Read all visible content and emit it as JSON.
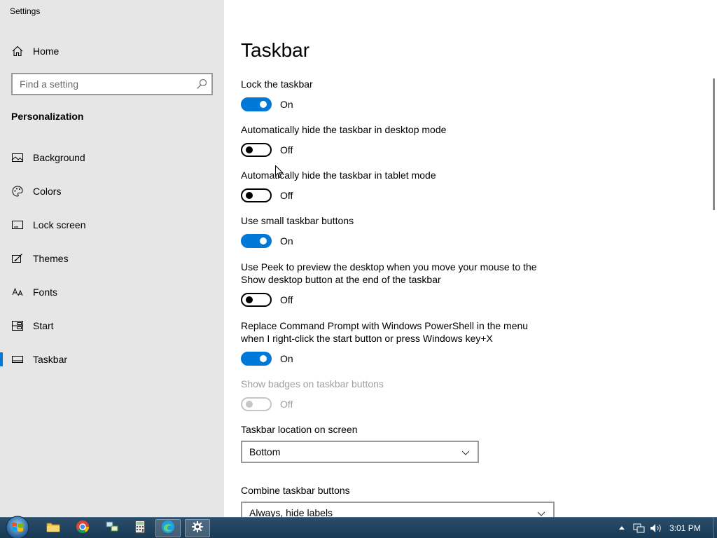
{
  "window": {
    "app_title": "Settings",
    "caption_buttons": [
      "minimize",
      "maximize",
      "close"
    ]
  },
  "nav": {
    "home_label": "Home",
    "search_placeholder": "Find a setting",
    "section_title": "Personalization",
    "items": [
      {
        "label": "Background",
        "icon": "picture-icon",
        "selected": false
      },
      {
        "label": "Colors",
        "icon": "palette-icon",
        "selected": false
      },
      {
        "label": "Lock screen",
        "icon": "lock-screen-icon",
        "selected": false
      },
      {
        "label": "Themes",
        "icon": "brush-icon",
        "selected": false
      },
      {
        "label": "Fonts",
        "icon": "font-icon",
        "selected": false
      },
      {
        "label": "Start",
        "icon": "start-tiles-icon",
        "selected": false
      },
      {
        "label": "Taskbar",
        "icon": "taskbar-icon",
        "selected": true
      }
    ],
    "accent_color": "#0078d7"
  },
  "main": {
    "page_title": "Taskbar",
    "settings": [
      {
        "label": "Lock the taskbar",
        "state": "On",
        "enabled": true
      },
      {
        "label": "Automatically hide the taskbar in desktop mode",
        "state": "Off",
        "enabled": true
      },
      {
        "label": "Automatically hide the taskbar in tablet mode",
        "state": "Off",
        "enabled": true
      },
      {
        "label": "Use small taskbar buttons",
        "state": "On",
        "enabled": true
      },
      {
        "label": "Use Peek to preview the desktop when you move your mouse to the Show desktop button at the end of the taskbar",
        "state": "Off",
        "enabled": true
      },
      {
        "label": "Replace Command Prompt with Windows PowerShell in the menu when I right-click the start button or press Windows key+X",
        "state": "On",
        "enabled": true
      },
      {
        "label": "Show badges on taskbar buttons",
        "state": "Off",
        "enabled": false
      }
    ],
    "location": {
      "label": "Taskbar location on screen",
      "value": "Bottom"
    },
    "combine": {
      "label": "Combine taskbar buttons",
      "value": "Always, hide labels"
    }
  },
  "taskbar": {
    "apps": [
      {
        "name": "File Explorer",
        "icon": "folder-icon",
        "active": false
      },
      {
        "name": "Chrome",
        "icon": "chrome-icon",
        "active": false
      },
      {
        "name": "Network",
        "icon": "network-app-icon",
        "active": false
      },
      {
        "name": "Calculator",
        "icon": "calculator-icon",
        "active": false
      },
      {
        "name": "Edge",
        "icon": "edge-icon",
        "active": false
      },
      {
        "name": "Settings",
        "icon": "gear-icon",
        "active": true
      }
    ],
    "clock": "3:01 PM",
    "tray_icons": [
      "chevron-up-icon",
      "network-icon",
      "volume-icon"
    ]
  }
}
